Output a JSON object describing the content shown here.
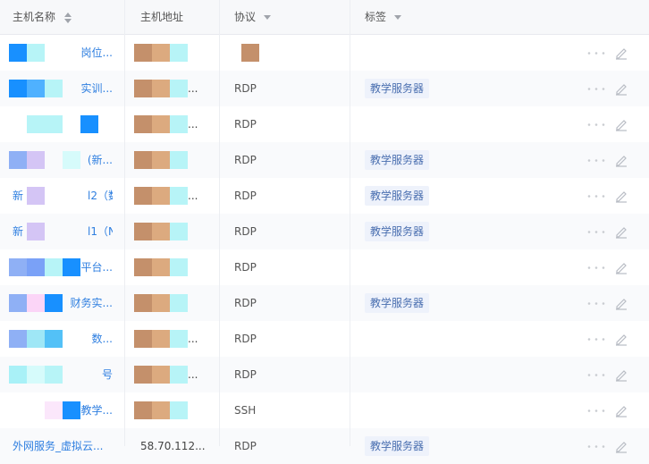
{
  "header": {
    "host_name": "主机名称",
    "host_addr": "主机地址",
    "protocol": "协议",
    "tags": "标签"
  },
  "rows": [
    {
      "name": "岗位...",
      "addr": "",
      "protocol": "",
      "tag": ""
    },
    {
      "name": "实训...",
      "addr": "...",
      "protocol": "RDP",
      "tag": "教学服务器"
    },
    {
      "name": "",
      "addr": "...",
      "protocol": "RDP",
      "tag": ""
    },
    {
      "name": "(新...",
      "addr": "",
      "protocol": "RDP",
      "tag": "教学服务器"
    },
    {
      "name": "新　　　　　　l2（数...",
      "addr": "...",
      "protocol": "RDP",
      "tag": "教学服务器"
    },
    {
      "name": "新　　　　　　l1（NC...",
      "addr": "",
      "protocol": "RDP",
      "tag": "教学服务器"
    },
    {
      "name": "平台...",
      "addr": "",
      "protocol": "RDP",
      "tag": ""
    },
    {
      "name": "财务实...",
      "addr": "",
      "protocol": "RDP",
      "tag": "教学服务器"
    },
    {
      "name": "数...",
      "addr": "...",
      "protocol": "RDP",
      "tag": ""
    },
    {
      "name": "号",
      "addr": "...",
      "protocol": "RDP",
      "tag": ""
    },
    {
      "name": "教学...",
      "addr": "",
      "protocol": "SSH",
      "tag": ""
    },
    {
      "name": "外网服务_虚拟云...",
      "addr": "58.70.112...",
      "protocol": "RDP",
      "tag": "教学服务器"
    }
  ],
  "colors": {
    "link": "#2f7fe0",
    "tag_bg": "#eef2fb",
    "tag_text": "#4a6fb0",
    "alt_row": "#f9fafc",
    "mask_tan": "#c4906b",
    "mask_peach": "#dcaa7f",
    "mask_cyan": "#b7f4f7",
    "mask_blue": "#1890ff"
  },
  "icons": [
    "sort-icon",
    "filter-arrow-icon",
    "more-icon",
    "edit-icon"
  ]
}
